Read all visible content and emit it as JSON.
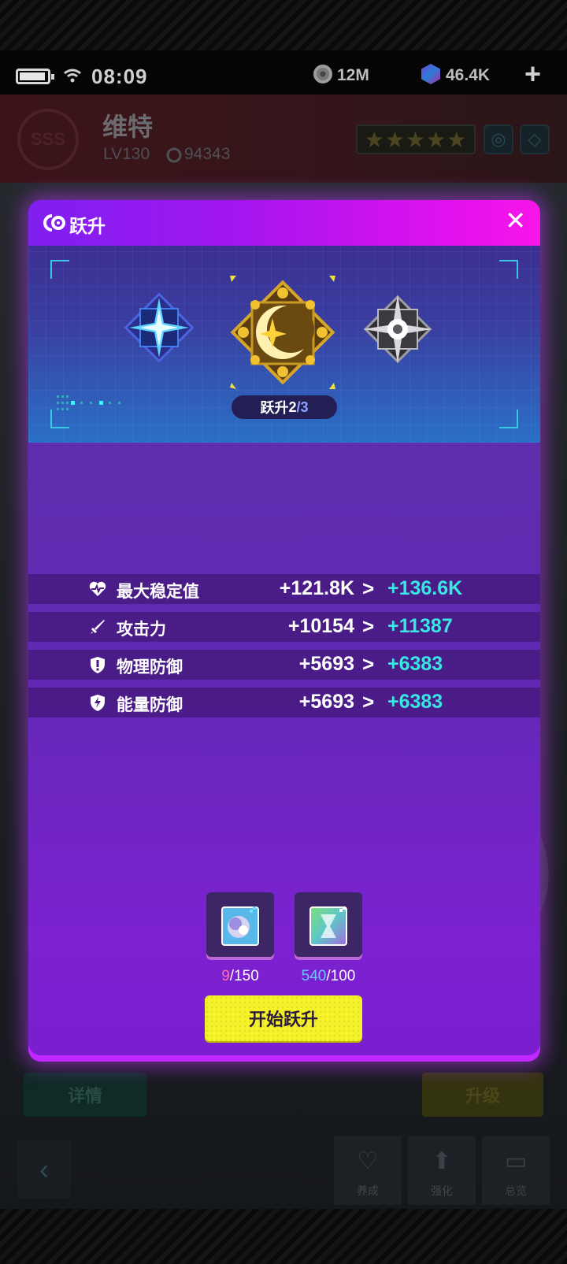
{
  "status": {
    "time": "08:09",
    "coins": "12M",
    "gems": "46.4K",
    "add_label": "+"
  },
  "character": {
    "rank": "SSS",
    "name": "维特",
    "level": "LV130",
    "power": "94343",
    "stars": "★★★★★"
  },
  "modal": {
    "title": "跃升",
    "close_label": "✕",
    "level_prefix": "跃升",
    "level_current": "2",
    "level_max": "/3",
    "stats": [
      {
        "icon": "heart-pulse-icon",
        "label": "最大稳定值",
        "current": "+121.8K",
        "next": "+136.6K"
      },
      {
        "icon": "sword-icon",
        "label": "攻击力",
        "current": "+10154",
        "next": "+11387"
      },
      {
        "icon": "shield-exclaim-icon",
        "label": "物理防御",
        "current": "+5693",
        "next": "+6383"
      },
      {
        "icon": "shield-bolt-icon",
        "label": "能量防御",
        "current": "+5693",
        "next": "+6383"
      }
    ],
    "arrow": ">",
    "materials": [
      {
        "icon": "character-shard-icon",
        "have": "9",
        "need": "/150"
      },
      {
        "icon": "data-chip-icon",
        "have": "540",
        "need": "/100"
      }
    ],
    "start_label": "开始跃升"
  },
  "background": {
    "detail_label": "详情",
    "upgrade_label": "升级",
    "nav": [
      {
        "icon": "heart-icon",
        "label": "养成"
      },
      {
        "icon": "chip-upgrade-icon",
        "label": "强化"
      },
      {
        "icon": "folder-icon",
        "label": "总览"
      }
    ]
  },
  "colors": {
    "header_gradient_start": "#7f1ff0",
    "header_gradient_end": "#f716e9",
    "next_value": "#3be6e2",
    "start_button": "#f5f229",
    "have_low": "#ff6fa8",
    "have_ok": "#6cc6ff"
  }
}
